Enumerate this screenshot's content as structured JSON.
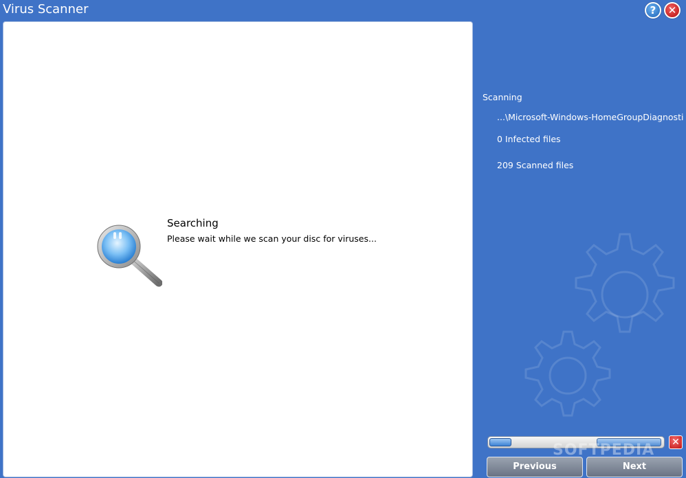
{
  "window": {
    "title": "Virus Scanner"
  },
  "titlebar": {
    "help_glyph": "?",
    "close_glyph": "✕"
  },
  "main": {
    "search_title": "Searching",
    "search_desc": "Please wait while we scan your disc for viruses...",
    "icon": "magnifier-icon"
  },
  "side": {
    "scanning_label": "Scanning",
    "current_path": "...\\Microsoft-Windows-HomeGroupDiagnostic.Ne",
    "infected_files": "0 Infected files",
    "scanned_files": "209 Scanned files",
    "progress": 0.12,
    "cancel_glyph": "✕",
    "previous_label": "Previous",
    "next_label": "Next",
    "watermark": "SOFTPEDIA"
  },
  "colors": {
    "background": "#3f73c7",
    "panel": "#ffffff",
    "accent": "#3d82d4",
    "close": "#c01414"
  }
}
